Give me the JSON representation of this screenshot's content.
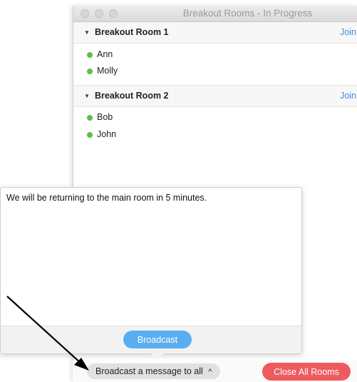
{
  "window": {
    "title": "Breakout Rooms - In Progress"
  },
  "rooms": [
    {
      "name": "Breakout Room 1",
      "join_label": "Join",
      "members": [
        "Ann",
        "Molly"
      ]
    },
    {
      "name": "Breakout Room 2",
      "join_label": "Join",
      "members": [
        "Bob",
        "John"
      ]
    }
  ],
  "broadcast_popup": {
    "message": "We will be returning to the main room in 5 minutes.",
    "button_label": "Broadcast"
  },
  "bottom_bar": {
    "broadcast_toggle_label": "Broadcast a message to all",
    "broadcast_toggle_icon": "chevron-up-icon",
    "close_all_label": "Close All Rooms"
  },
  "colors": {
    "join_link": "#3a8ee6",
    "online_dot": "#5fbe48",
    "broadcast_button": "#5aaef0",
    "close_button": "#ee5b5f"
  }
}
